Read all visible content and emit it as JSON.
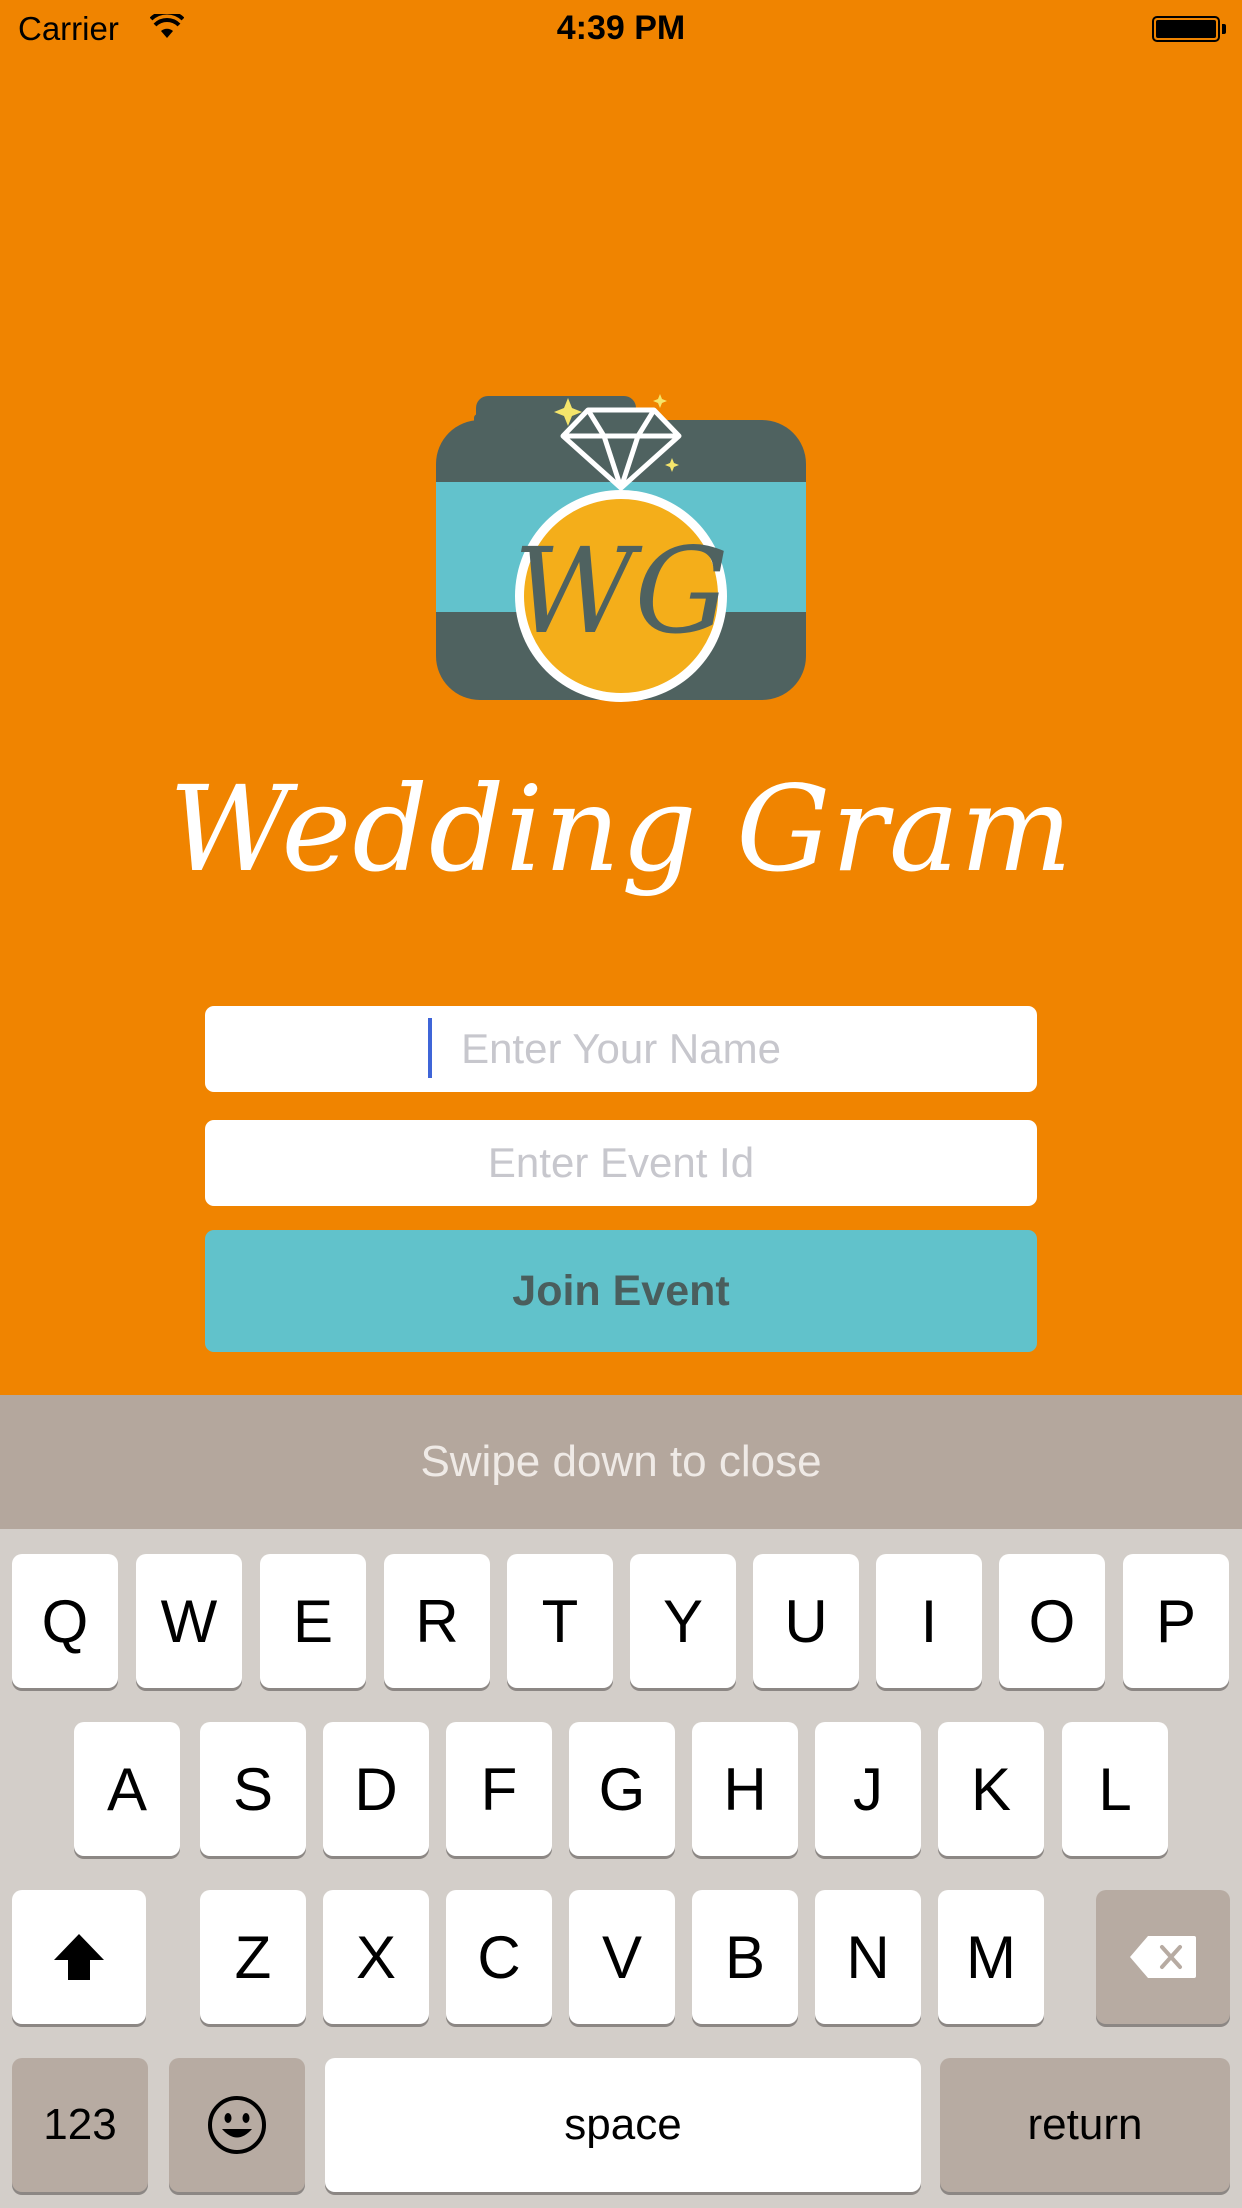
{
  "status_bar": {
    "carrier": "Carrier",
    "time": "4:39 PM"
  },
  "logo": {
    "monogram": "WG",
    "icon": "camera-ring-logo-icon"
  },
  "app_title": "Wedding Gram",
  "form": {
    "name_placeholder": "Enter Your Name",
    "name_value": "",
    "event_placeholder": "Enter Event Id",
    "event_value": "",
    "join_label": "Join Event"
  },
  "keyboard_hint": "Swipe down to close",
  "keyboard": {
    "row1": [
      "Q",
      "W",
      "E",
      "R",
      "T",
      "Y",
      "U",
      "I",
      "O",
      "P"
    ],
    "row2": [
      "A",
      "S",
      "D",
      "F",
      "G",
      "H",
      "J",
      "K",
      "L"
    ],
    "row3": [
      "Z",
      "X",
      "C",
      "V",
      "B",
      "N",
      "M"
    ],
    "numbers_label": "123",
    "space_label": "space",
    "return_label": "return",
    "shift_icon": "shift-icon",
    "delete_icon": "delete-icon",
    "emoji_icon": "emoji-icon"
  },
  "colors": {
    "background": "#F08400",
    "button": "#61C2CB",
    "hint_bar": "#B4A79D",
    "keyboard": "#D3CEC9"
  }
}
